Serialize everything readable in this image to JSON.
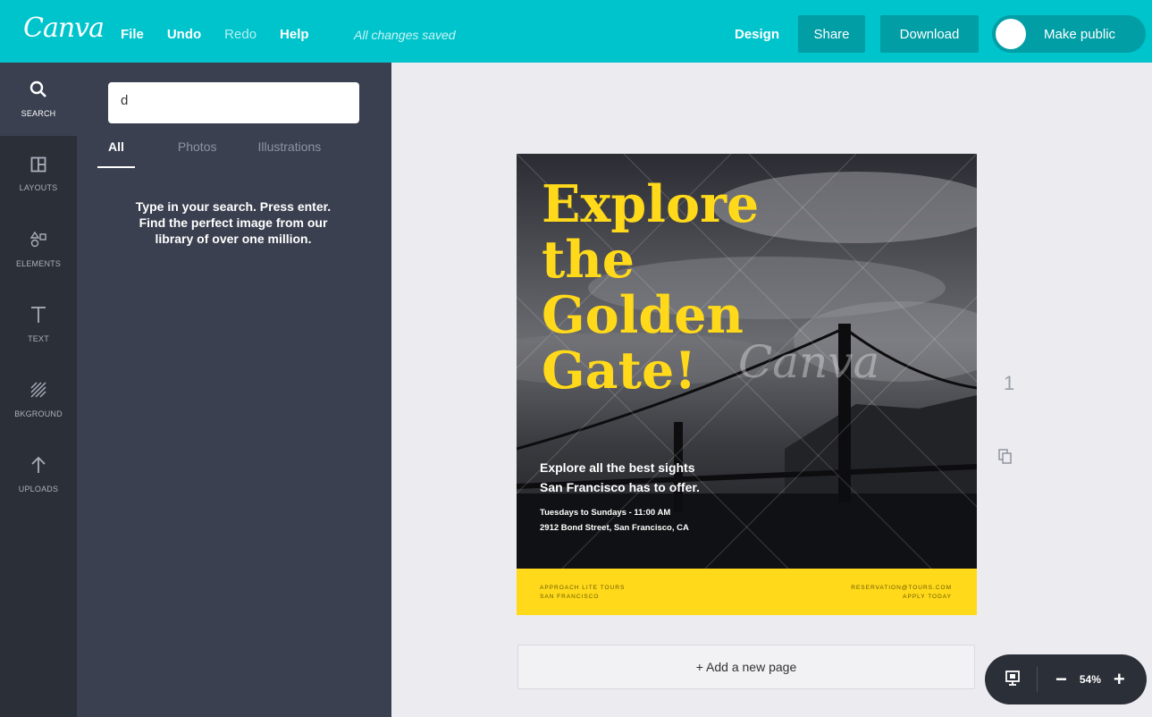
{
  "app": {
    "logo": "Canva",
    "menu": {
      "file": "File",
      "undo": "Undo",
      "redo": "Redo",
      "help": "Help"
    },
    "saved_status": "All changes saved",
    "design_label": "Design",
    "share_label": "Share",
    "download_label": "Download",
    "make_public_label": "Make public"
  },
  "rail": {
    "items": [
      {
        "label": "SEARCH",
        "icon": "search-icon"
      },
      {
        "label": "LAYOUTS",
        "icon": "layouts-icon"
      },
      {
        "label": "ELEMENTS",
        "icon": "elements-icon"
      },
      {
        "label": "TEXT",
        "icon": "text-icon"
      },
      {
        "label": "BKGROUND",
        "icon": "background-icon"
      },
      {
        "label": "UPLOADS",
        "icon": "upload-icon"
      }
    ]
  },
  "search": {
    "value": "d",
    "tabs": [
      "All",
      "Photos",
      "Illustrations"
    ],
    "hint": "Type in your search. Press enter. Find the perfect image from our library of over one million."
  },
  "design": {
    "headline_lines": [
      "Explore",
      "the",
      "Golden",
      "Gate!"
    ],
    "watermark": "Canva",
    "sub_lines": [
      "Explore all the best sights",
      "San Francisco has to offer."
    ],
    "detail_lines": [
      "Tuesdays to Sundays  -  11:00 AM",
      "2912 Bond Street, San Francisco, CA"
    ],
    "footer_left_lines": [
      "APPROACH LITE TOURS",
      "SAN FRANCISCO"
    ],
    "footer_right_lines": [
      "RESERVATION@TOURS.COM",
      "APPLY TODAY"
    ],
    "colors": {
      "accent_yellow": "#ffd91a",
      "brand_teal": "#00c4cc"
    }
  },
  "page_number": "1",
  "add_page_label": "+ Add a new page",
  "zoom": {
    "level": "54%",
    "minus": "−",
    "plus": "+"
  }
}
